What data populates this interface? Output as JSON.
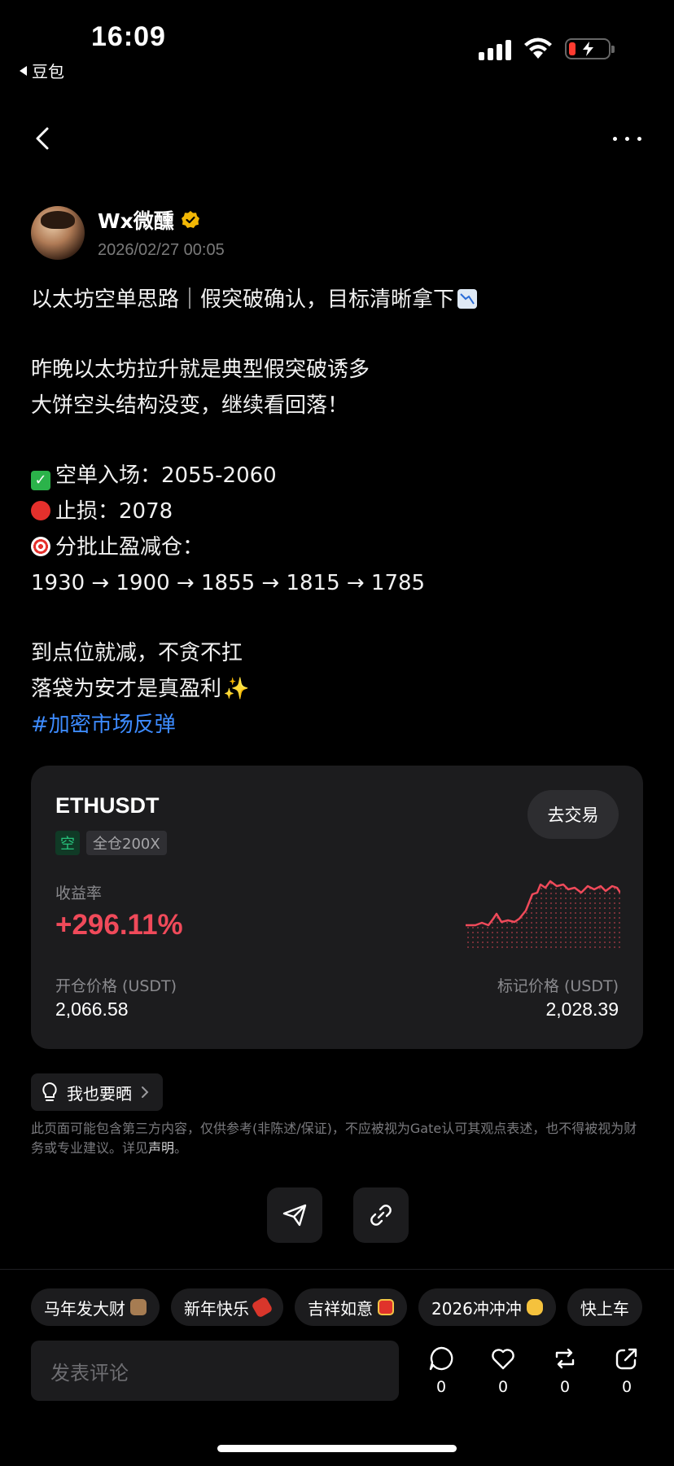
{
  "status_bar": {
    "time": "16:09",
    "back_app": "豆包"
  },
  "author": {
    "name": "Wx微醺",
    "date": "2026/02/27 00:05"
  },
  "post": {
    "title": "以太坊空单思路｜假突破确认，目标清晰拿下",
    "line1": "昨晚以太坊拉升就是典型假突破诱多",
    "line2": "大饼空头结构没变，继续看回落！",
    "entry": "空单入场：2055-2060",
    "stop": "止损：2078",
    "tp_label": "分批止盈减仓：",
    "tp_values": "1930 → 1900 → 1855 → 1815 → 1785",
    "line3": "到点位就减，不贪不扛",
    "line4": "落袋为安才是真盈利",
    "hashtag": "#加密市场反弹"
  },
  "card": {
    "symbol": "ETHUSDT",
    "trade_button": "去交易",
    "side_tag": "空",
    "leverage_tag": "全仓200X",
    "roi_label": "收益率",
    "roi_value": "+296.11%",
    "open_price_label": "开仓价格 (USDT)",
    "open_price": "2,066.58",
    "mark_price_label": "标记价格 (USDT)",
    "mark_price": "2,028.39",
    "colors": {
      "roi": "#f04a5a",
      "short_tag": "#27c17b"
    }
  },
  "share_chip": "我也要晒",
  "disclaimer": {
    "text": "此页面可能包含第三方内容，仅供参考(非陈述/保证)，不应被视为Gate认可其观点表述，也不得被视为财务或专业建议。详见",
    "link": "声明",
    "end": "。"
  },
  "quick_replies": [
    "马年发大财",
    "新年快乐",
    "吉祥如意",
    "2026冲冲冲",
    "快上车"
  ],
  "comment": {
    "placeholder": "发表评论"
  },
  "counters": {
    "comments": "0",
    "likes": "0",
    "reposts": "0",
    "shares": "0"
  },
  "icons": [
    "back-icon",
    "more-icon",
    "verified-icon",
    "lightbulb-icon",
    "chevron-right-icon",
    "send-icon",
    "link-icon",
    "comment-icon",
    "heart-icon",
    "repost-icon",
    "share-icon"
  ]
}
